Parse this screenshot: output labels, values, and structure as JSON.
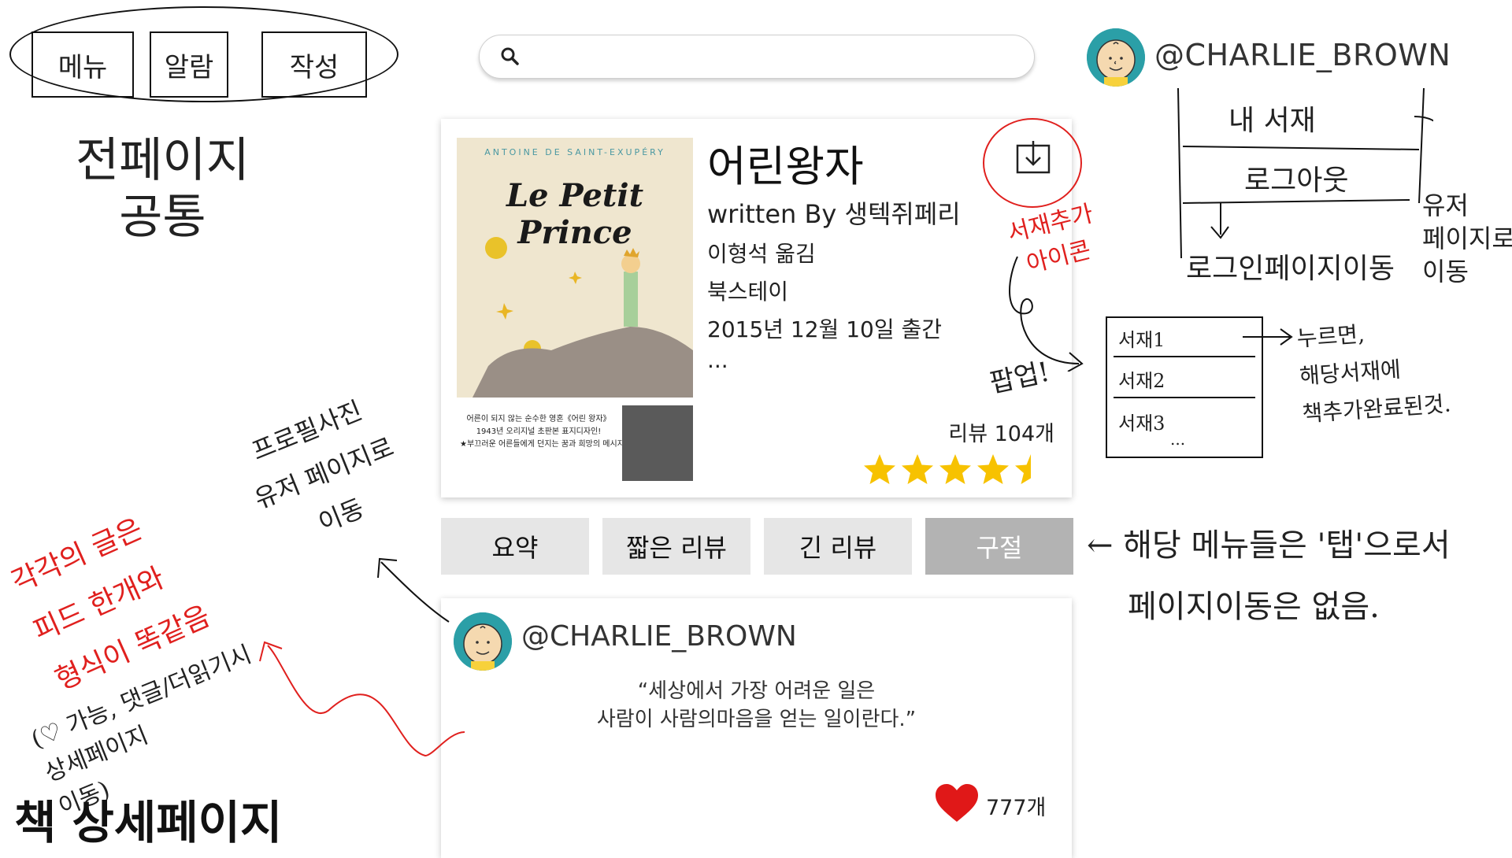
{
  "nav": {
    "items": [
      {
        "label": "메뉴"
      },
      {
        "label": "알람"
      },
      {
        "label": "작성"
      }
    ]
  },
  "annotations": {
    "nav_common": "전페이지\n공통",
    "shelf_icon": "서재추가\n아이콘",
    "popup": "팝업!",
    "login_move": "로그인페이지이동",
    "user_page_move": "유저\n페이지로\n이동",
    "shelf_click": "누르면,\n해당서재에\n책추가완료된것.",
    "tabs_note_1": "← 해당 메뉴들은 '탭'으로서",
    "tabs_note_2": "페이지이동은 없음.",
    "profile_click": "프로필사진\n유저 페이지로\n이동",
    "feed_note": "각각의 글은\n피드 한개와\n형식이 똑같음",
    "feed_sub": "(♡ 가능, 댓글/더읽기시\n상세페이지\n이동)",
    "page_label": "책 상세페이지"
  },
  "search": {
    "placeholder": "",
    "icon": "search-icon"
  },
  "profile": {
    "username": "@CHARLIE_BROWN",
    "avatar": "charlie-brown-avatar"
  },
  "user_menu": {
    "items": [
      "내 서재",
      "로그아웃"
    ]
  },
  "shelf_popup": {
    "items": [
      "서재1",
      "서재2",
      "서재3",
      "..."
    ]
  },
  "book": {
    "title": "어린왕자",
    "author": "written By 생텍쥐페리",
    "translator": "이형석 옮김",
    "publisher": "북스테이",
    "published": "2015년 12월 10일 출간",
    "more": "...",
    "review_count": "리뷰 104개",
    "rating": 4.5,
    "rating_max": 5,
    "cover": {
      "author": "ANTOINE DE SAINT-EXUPÉRY",
      "title": "Le Petit Prince",
      "tagline": "어른이 되지 않는 순수한 영혼《어린 왕자》\n1943년 오리지널 초판본 표지디자인!\n★부끄러운 어른들에게 던지는 꿈과 희망의 메시지★"
    }
  },
  "tabs": [
    {
      "label": "요약",
      "active": false
    },
    {
      "label": "짧은 리뷰",
      "active": false
    },
    {
      "label": "긴 리뷰",
      "active": false
    },
    {
      "label": "구절",
      "active": true
    }
  ],
  "feed": {
    "username": "@CHARLIE_BROWN",
    "quote_line1": "“세상에서 가장 어려운 일은",
    "quote_line2": "사람이 사람의마음을 얻는 일이란다.”",
    "likes": "777개"
  },
  "colors": {
    "star": "#f7c200",
    "heart": "#e01818",
    "annotation_red": "#e0201e",
    "tab_active": "#b3b3b3",
    "tab": "#e6e6e6"
  }
}
